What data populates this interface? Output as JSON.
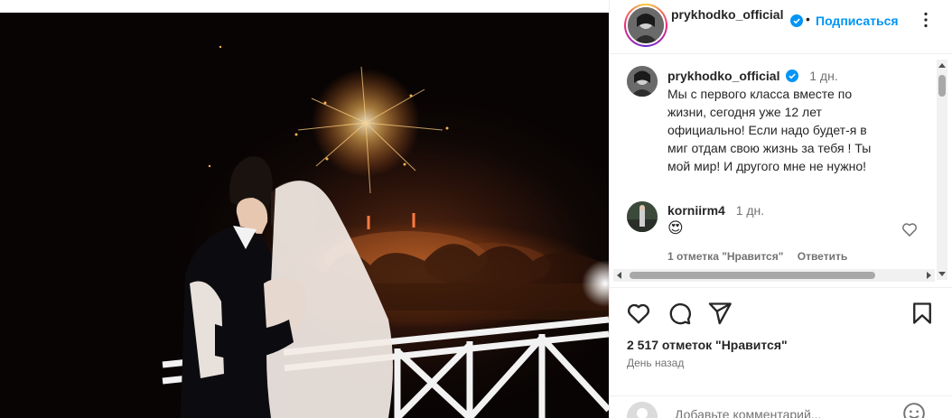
{
  "post_image": {
    "alt_icon": "wedding-photo"
  },
  "header": {
    "username": "prykhodko_official",
    "verified_icon": "verified-badge-icon",
    "separator": "•",
    "follow_label": "Подписаться",
    "more_icon": "more-options-icon"
  },
  "caption": {
    "username": "prykhodko_official",
    "time": "1 дн.",
    "text": "Мы с первого класса вместе по жизни, сегодня уже 12 лет официально! Если надо будет-я в миг отдам свою жизнь за тебя ! Ты мой мир! И другого мне не нужно!"
  },
  "comments": [
    {
      "username": "korniirm4",
      "time": "1 дн.",
      "text": "😍",
      "likes_label": "1 отметка \"Нравится\"",
      "reply_label": "Ответить"
    }
  ],
  "actions": {
    "like_icon": "heart-icon",
    "comment_icon": "comment-icon",
    "share_icon": "share-icon",
    "save_icon": "bookmark-icon"
  },
  "likes_text": "2 517 отметок \"Нравится\"",
  "date_text": "День назад",
  "add_comment": {
    "placeholder": "Добавьте комментарий...",
    "emoji_icon": "emoji-icon"
  },
  "colors": {
    "accent": "#0095f6",
    "text": "#262626",
    "secondary": "#737373",
    "border": "#efefef"
  }
}
